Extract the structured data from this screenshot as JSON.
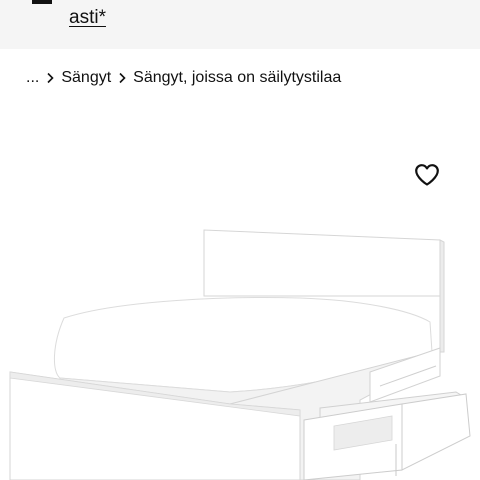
{
  "promo_banner": {
    "text": "asti*",
    "icon": "truck-icon"
  },
  "breadcrumb": {
    "items": [
      {
        "label": "..."
      },
      {
        "label": "Sängyt"
      },
      {
        "label": "Sängyt, joissa on säilytystilaa"
      }
    ],
    "separator_icon": "chevron-right-icon"
  },
  "product": {
    "favourite_icon": "heart-icon",
    "image_subject": "bed-with-storage-drawers",
    "colors": {
      "frame": "#ffffff",
      "outline": "#d8d8d8",
      "shadow": "#e9e9e9"
    }
  }
}
